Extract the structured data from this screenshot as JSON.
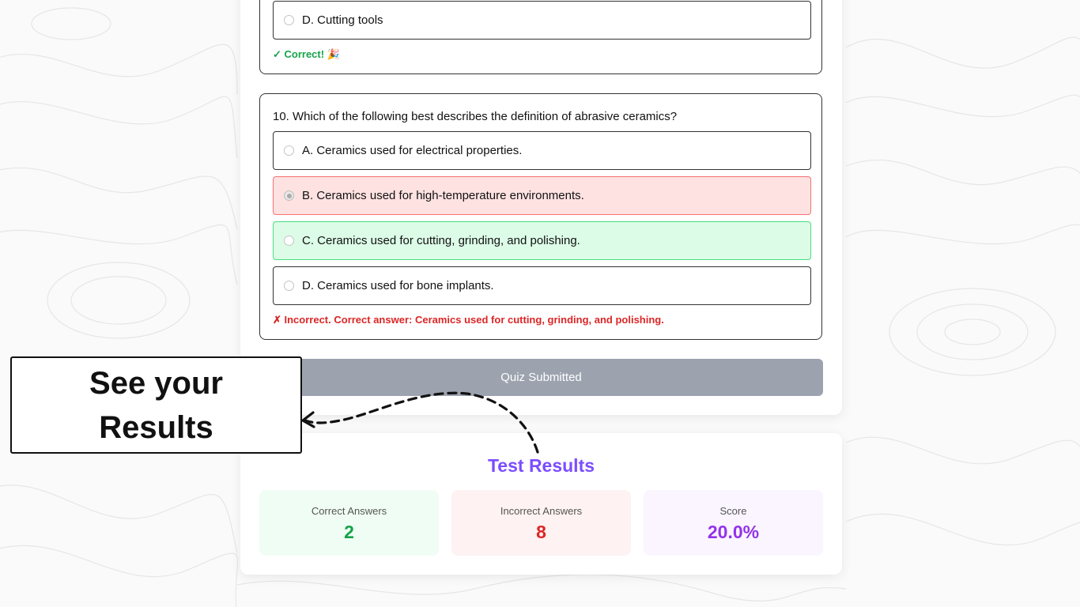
{
  "question9": {
    "option_d": "D. Cutting tools",
    "feedback": "✓ Correct! 🎉"
  },
  "question10": {
    "text": "10. Which of the following best describes the definition of abrasive ceramics?",
    "options": [
      {
        "label": "A. Ceramics used for electrical properties.",
        "state": "neutral"
      },
      {
        "label": "B. Ceramics used for high-temperature environments.",
        "state": "selected-incorrect"
      },
      {
        "label": "C. Ceramics used for cutting, grinding, and polishing.",
        "state": "correct"
      },
      {
        "label": "D. Ceramics used for bone implants.",
        "state": "neutral"
      }
    ],
    "feedback": "✗ Incorrect. Correct answer: Ceramics used for cutting, grinding, and polishing."
  },
  "submit_button": {
    "label": "Quiz Submitted",
    "state": "disabled"
  },
  "results": {
    "title": "Test Results",
    "correct": {
      "label": "Correct Answers",
      "value": "2"
    },
    "incorrect": {
      "label": "Incorrect Answers",
      "value": "8"
    },
    "score": {
      "label": "Score",
      "value": "20.0%"
    }
  },
  "callout": {
    "line1": "See your",
    "line2": "Results"
  },
  "colors": {
    "correct": "#16a34a",
    "incorrect": "#dc2626",
    "score": "#9333ea",
    "title": "#7c4dff",
    "submit_disabled": "#9ca3af"
  }
}
